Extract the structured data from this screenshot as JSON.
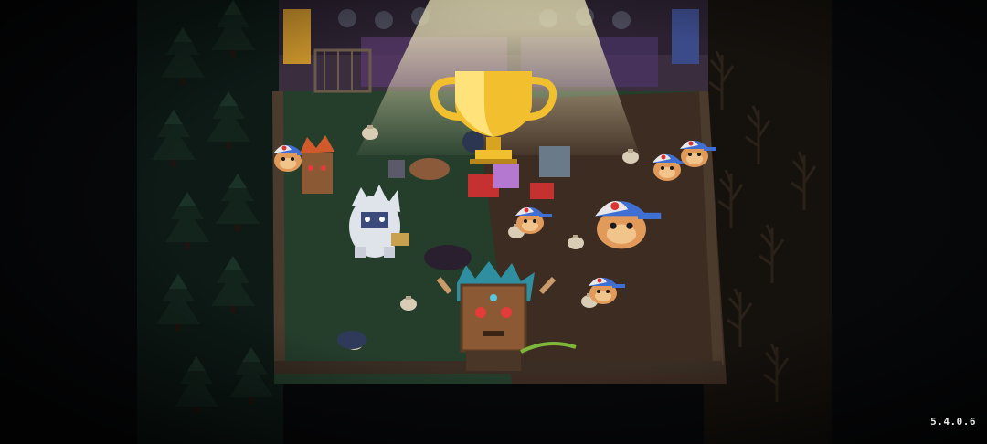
{
  "game": {
    "version_label": "5.4.0.6",
    "trophy_icon": "gold-trophy-icon"
  },
  "colors": {
    "background": "#07080a",
    "forest_dark": "#0d1a16",
    "grass": "#253e2c",
    "dirt": "#3d2c22",
    "spotlight": "#fff7c8",
    "trophy_gold": "#f2c02e",
    "cap_blue": "#3f6fd3",
    "cap_white": "#e8e8ea",
    "monkey_skin": "#e29a5a"
  }
}
